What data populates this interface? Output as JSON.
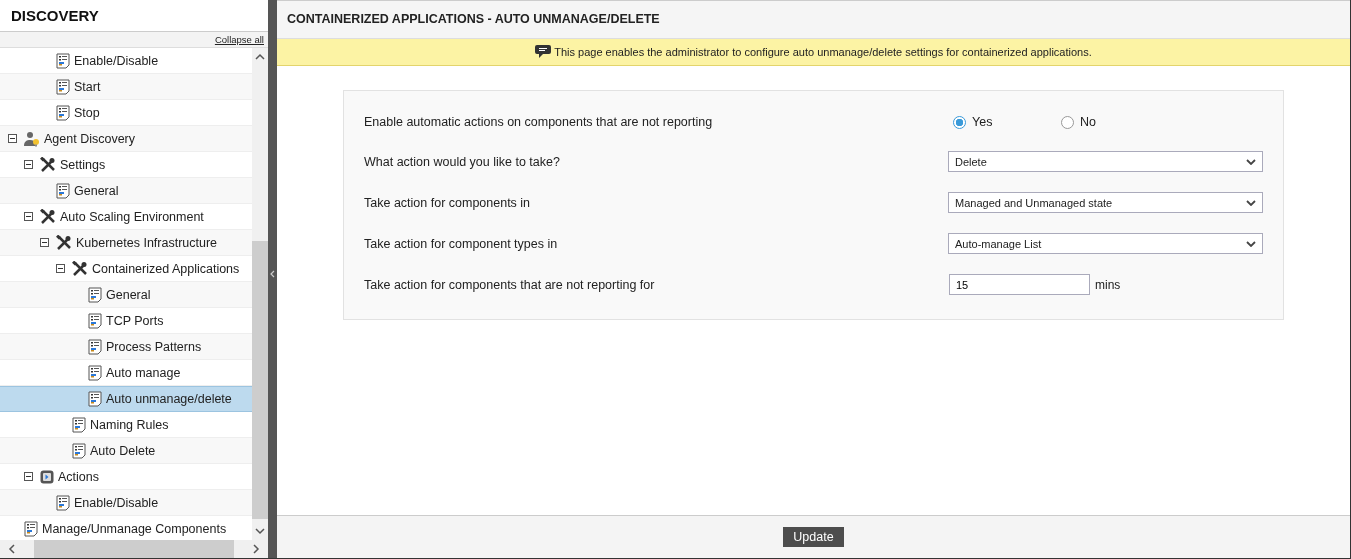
{
  "sidebar": {
    "title": "DISCOVERY",
    "collapse_link": "Collapse all",
    "tree": [
      {
        "children": [
          {
            "children": [
              {
                "label": "Enable/Disable",
                "kind": "page",
                "selected": false
              },
              {
                "label": "Start",
                "kind": "page",
                "selected": false
              },
              {
                "label": "Stop",
                "kind": "page",
                "selected": false
              }
            ]
          }
        ]
      },
      {
        "label": "Agent Discovery",
        "kind": "agent",
        "expanded": true,
        "selected": false,
        "children": [
          {
            "label": "Settings",
            "kind": "tools",
            "expanded": true,
            "selected": false,
            "children": [
              {
                "label": "General",
                "kind": "page",
                "selected": false
              }
            ]
          },
          {
            "label": "Auto Scaling Environment",
            "kind": "tools",
            "expanded": true,
            "selected": false,
            "children": [
              {
                "label": "Kubernetes Infrastructure",
                "kind": "tools",
                "expanded": true,
                "selected": false,
                "children": [
                  {
                    "label": "Containerized Applications",
                    "kind": "tools",
                    "expanded": true,
                    "selected": false,
                    "children": [
                      {
                        "label": "General",
                        "kind": "page",
                        "selected": false
                      },
                      {
                        "label": "TCP Ports",
                        "kind": "page",
                        "selected": false
                      },
                      {
                        "label": "Process Patterns",
                        "kind": "page",
                        "selected": false
                      },
                      {
                        "label": "Auto manage",
                        "kind": "page",
                        "selected": false
                      },
                      {
                        "label": "Auto unmanage/delete",
                        "kind": "page",
                        "selected": true
                      }
                    ]
                  },
                  {
                    "label": "Naming Rules",
                    "kind": "page",
                    "selected": false
                  },
                  {
                    "label": "Auto Delete",
                    "kind": "page",
                    "selected": false
                  }
                ]
              }
            ]
          },
          {
            "label": "Actions",
            "kind": "actions",
            "expanded": true,
            "selected": false,
            "children": [
              {
                "label": "Enable/Disable",
                "kind": "page",
                "selected": false
              }
            ]
          }
        ]
      },
      {
        "label": "Manage/Unmanage Components",
        "kind": "page",
        "selected": false
      }
    ]
  },
  "main": {
    "title": "CONTAINERIZED APPLICATIONS - AUTO UNMANAGE/DELETE",
    "info": "This page enables the administrator to configure auto unmanage/delete settings for containerized applications.",
    "fields": [
      {
        "kind": "radio",
        "label": "Enable automatic actions on components that are not reporting",
        "options": [
          {
            "label": "Yes",
            "selected": true
          },
          {
            "label": "No",
            "selected": false
          }
        ]
      },
      {
        "kind": "select",
        "label": "What action would you like to take?",
        "value": "Delete"
      },
      {
        "kind": "select",
        "label": "Take action for components in",
        "value": "Managed and Unmanaged state"
      },
      {
        "kind": "select",
        "label": "Take action for component types in",
        "value": "Auto-manage List"
      },
      {
        "kind": "text",
        "label": "Take action for components that are not reporting for",
        "value": "15",
        "unit": "mins"
      }
    ],
    "button": "Update"
  }
}
